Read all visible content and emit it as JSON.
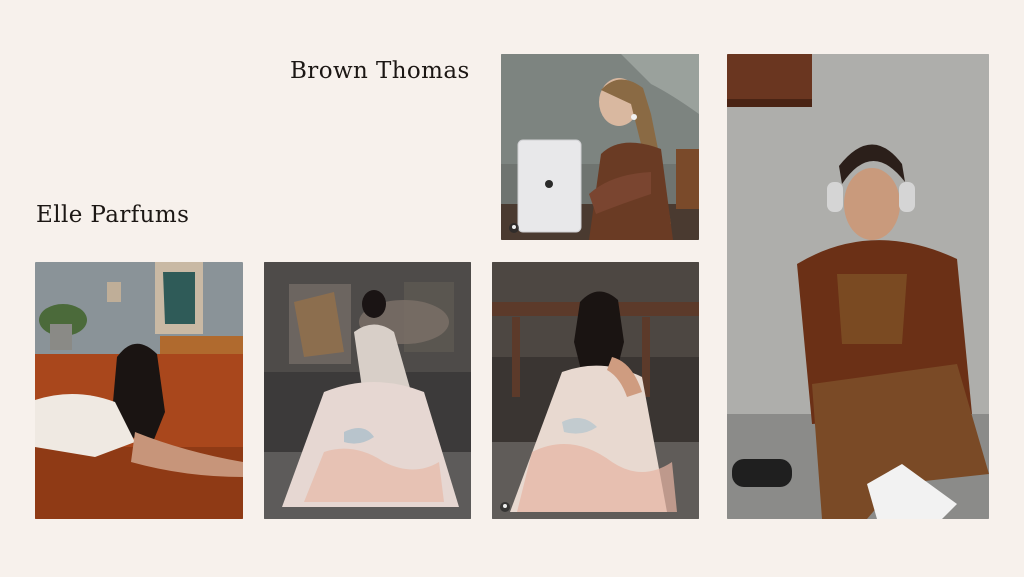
{
  "sections": {
    "brown_thomas": {
      "title": "Brown Thomas"
    },
    "elle_parfums": {
      "title": "Elle Parfums"
    }
  },
  "photos": [
    {
      "id": "woman-tablet-earbuds",
      "description_icon": "photo"
    },
    {
      "id": "man-headphones-brown-suit",
      "description_icon": "photo"
    },
    {
      "id": "woman-sofa",
      "description_icon": "photo"
    },
    {
      "id": "woman-dress-back",
      "description_icon": "photo"
    },
    {
      "id": "woman-dress-crouching",
      "description_icon": "photo"
    }
  ],
  "colors": {
    "background": "#f7f1ec",
    "heading": "#1c1714"
  }
}
